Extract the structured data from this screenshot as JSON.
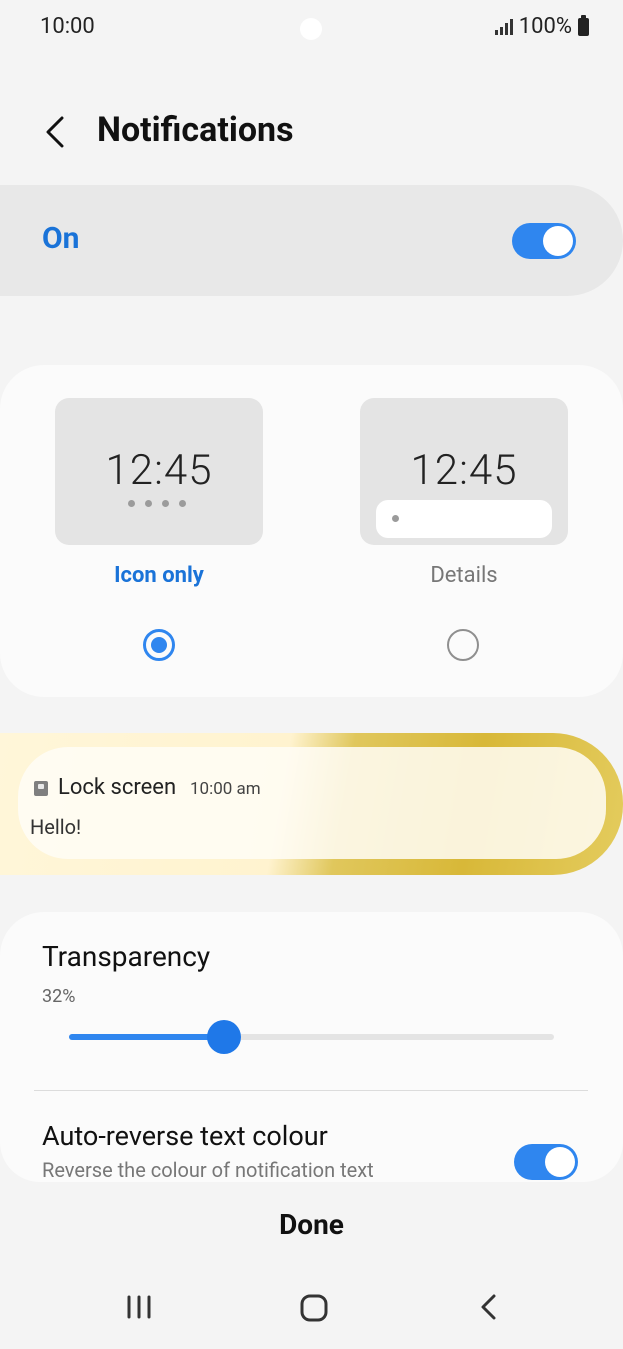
{
  "status_bar": {
    "time": "10:00",
    "battery": "100%"
  },
  "header": {
    "title": "Notifications"
  },
  "main_toggle": {
    "label": "On",
    "state": "on"
  },
  "notification_style": {
    "options": [
      {
        "preview_time": "12:45",
        "label": "Icon only",
        "selected": true
      },
      {
        "preview_time": "12:45",
        "label": "Details",
        "selected": false
      }
    ]
  },
  "lock_preview": {
    "app": "Lock screen",
    "time": "10:00 am",
    "message": "Hello!"
  },
  "transparency": {
    "label": "Transparency",
    "value_text": "32%",
    "value": 0.32
  },
  "auto_reverse": {
    "label": "Auto-reverse text colour",
    "description": "Reverse the colour of notification text",
    "state": "on"
  },
  "footer": {
    "done_label": "Done"
  },
  "colors": {
    "accent": "#2f86ef",
    "label_blue": "#1a73d8"
  },
  "nav_bar": {
    "icons": [
      "recents-icon",
      "home-icon",
      "back-icon"
    ]
  }
}
